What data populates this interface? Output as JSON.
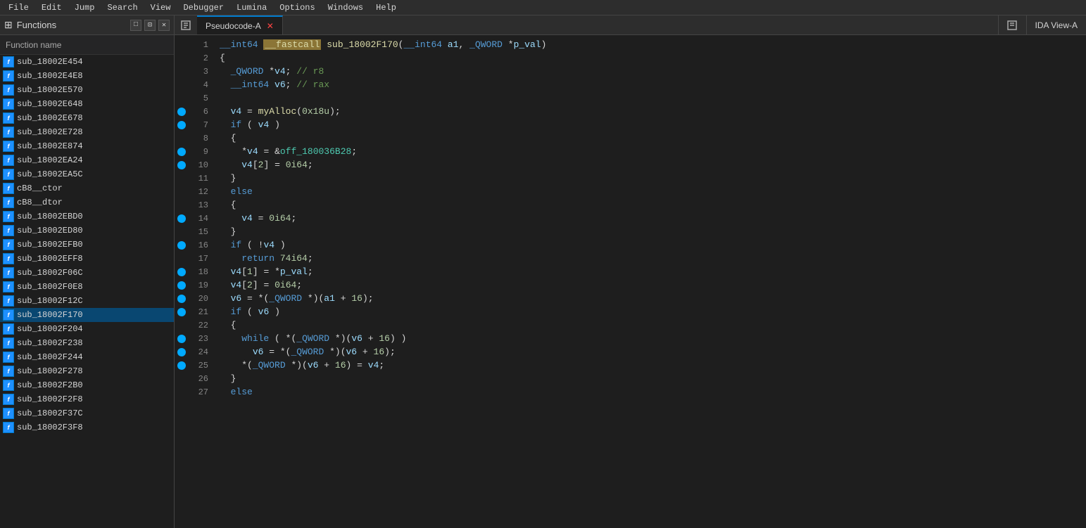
{
  "menubar": {
    "items": [
      "File",
      "Edit",
      "Jump",
      "Search",
      "View",
      "Debugger",
      "Lumina",
      "Options",
      "Windows",
      "Help"
    ]
  },
  "left_panel": {
    "title": "Functions",
    "header": "Function name",
    "controls": [
      "□",
      "⊡",
      "✕"
    ],
    "functions": [
      {
        "name": "sub_18002E454",
        "selected": false
      },
      {
        "name": "sub_18002E4E8",
        "selected": false
      },
      {
        "name": "sub_18002E570",
        "selected": false
      },
      {
        "name": "sub_18002E648",
        "selected": false
      },
      {
        "name": "sub_18002E678",
        "selected": false
      },
      {
        "name": "sub_18002E728",
        "selected": false
      },
      {
        "name": "sub_18002E874",
        "selected": false
      },
      {
        "name": "sub_18002EA24",
        "selected": false
      },
      {
        "name": "sub_18002EA5C",
        "selected": false
      },
      {
        "name": "cB8__ctor",
        "selected": false
      },
      {
        "name": "cB8__dtor",
        "selected": false
      },
      {
        "name": "sub_18002EBD0",
        "selected": false
      },
      {
        "name": "sub_18002ED80",
        "selected": false
      },
      {
        "name": "sub_18002EFB0",
        "selected": false
      },
      {
        "name": "sub_18002EFF8",
        "selected": false
      },
      {
        "name": "sub_18002F06C",
        "selected": false
      },
      {
        "name": "sub_18002F0E8",
        "selected": false
      },
      {
        "name": "sub_18002F12C",
        "selected": false
      },
      {
        "name": "sub_18002F170",
        "selected": true
      },
      {
        "name": "sub_18002F204",
        "selected": false
      },
      {
        "name": "sub_18002F238",
        "selected": false
      },
      {
        "name": "sub_18002F244",
        "selected": false
      },
      {
        "name": "sub_18002F278",
        "selected": false
      },
      {
        "name": "sub_18002F2B0",
        "selected": false
      },
      {
        "name": "sub_18002F2F8",
        "selected": false
      },
      {
        "name": "sub_18002F37C",
        "selected": false
      },
      {
        "name": "sub_18002F3F8",
        "selected": false
      }
    ]
  },
  "tab": {
    "label": "Pseudocode-A",
    "right_tab": "IDA View-A"
  },
  "code": {
    "lines": [
      {
        "num": 1,
        "bp": false,
        "content": "__int64 __fastcall sub_18002F170(__int64 a1, _QWORD *p_val)"
      },
      {
        "num": 2,
        "bp": false,
        "content": "{"
      },
      {
        "num": 3,
        "bp": false,
        "content": "  _QWORD *v4; // r8"
      },
      {
        "num": 4,
        "bp": false,
        "content": "  __int64 v6; // rax"
      },
      {
        "num": 5,
        "bp": false,
        "content": ""
      },
      {
        "num": 6,
        "bp": true,
        "content": "  v4 = myAlloc(0x18u);"
      },
      {
        "num": 7,
        "bp": true,
        "content": "  if ( v4 )"
      },
      {
        "num": 8,
        "bp": false,
        "content": "  {"
      },
      {
        "num": 9,
        "bp": true,
        "content": "    *v4 = &off_180036B28;"
      },
      {
        "num": 10,
        "bp": true,
        "content": "    v4[2] = 0i64;"
      },
      {
        "num": 11,
        "bp": false,
        "content": "  }"
      },
      {
        "num": 12,
        "bp": false,
        "content": "  else"
      },
      {
        "num": 13,
        "bp": false,
        "content": "  {"
      },
      {
        "num": 14,
        "bp": true,
        "content": "    v4 = 0i64;"
      },
      {
        "num": 15,
        "bp": false,
        "content": "  }"
      },
      {
        "num": 16,
        "bp": true,
        "content": "  if ( !v4 )"
      },
      {
        "num": 17,
        "bp": false,
        "content": "    return 74i64;"
      },
      {
        "num": 18,
        "bp": true,
        "content": "  v4[1] = *p_val;"
      },
      {
        "num": 19,
        "bp": true,
        "content": "  v4[2] = 0i64;"
      },
      {
        "num": 20,
        "bp": true,
        "content": "  v6 = *(_QWORD *)(a1 + 16);"
      },
      {
        "num": 21,
        "bp": true,
        "content": "  if ( v6 )"
      },
      {
        "num": 22,
        "bp": false,
        "content": "  {"
      },
      {
        "num": 23,
        "bp": true,
        "content": "    while ( *(_QWORD *)(v6 + 16) )"
      },
      {
        "num": 24,
        "bp": true,
        "content": "      v6 = *(_QWORD *)(v6 + 16);"
      },
      {
        "num": 25,
        "bp": true,
        "content": "    *(_QWORD *)(v6 + 16) = v4;"
      },
      {
        "num": 26,
        "bp": false,
        "content": "  }"
      },
      {
        "num": 27,
        "bp": false,
        "content": "  else"
      }
    ]
  }
}
